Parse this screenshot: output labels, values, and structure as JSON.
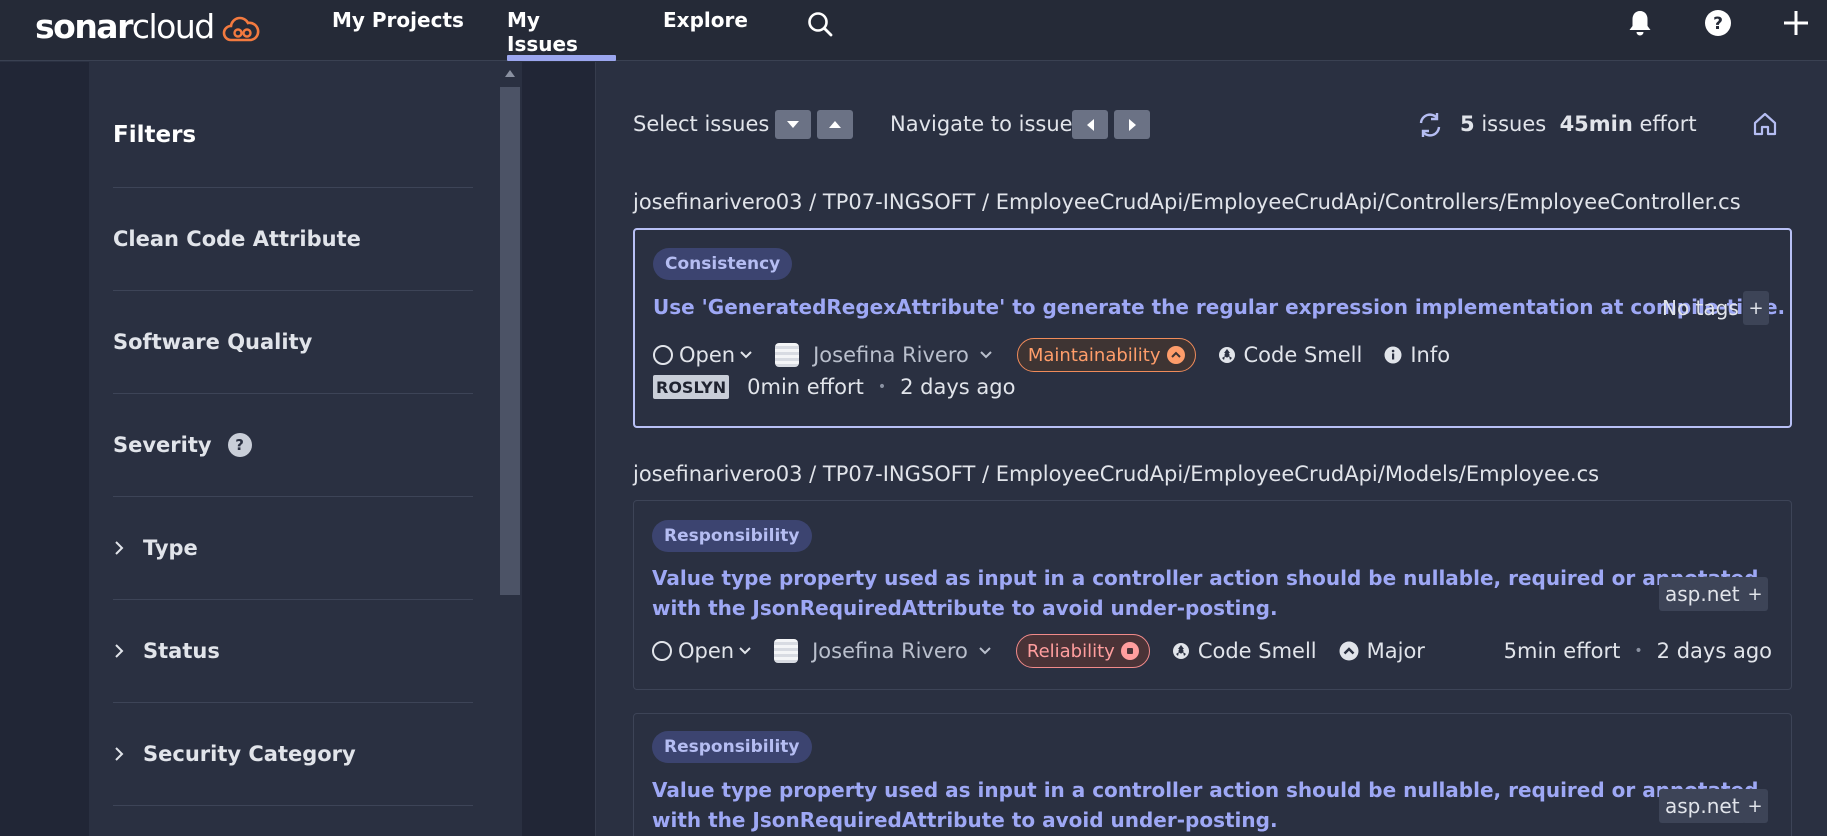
{
  "logo": {
    "bold": "sonar",
    "light": "cloud"
  },
  "nav": {
    "links": [
      {
        "label": "My Projects"
      },
      {
        "label": "My Issues"
      },
      {
        "label": "Explore"
      }
    ],
    "active": "My Issues"
  },
  "sidebar": {
    "title": "Filters",
    "facets": [
      {
        "label": "Clean Code Attribute",
        "expandable": false
      },
      {
        "label": "Software Quality",
        "expandable": false
      },
      {
        "label": "Severity",
        "expandable": false,
        "help": "?"
      },
      {
        "label": "Type",
        "expandable": true
      },
      {
        "label": "Status",
        "expandable": true
      },
      {
        "label": "Security Category",
        "expandable": true
      }
    ]
  },
  "toolbar": {
    "select_label": "Select issues",
    "navigate_label": "Navigate to issue",
    "issue_count": "5",
    "issues_word": "issues",
    "effort_value": "45min",
    "effort_word": "effort"
  },
  "issues": [
    {
      "path": "josefinarivero03 / TP07-INGSOFT / EmployeeCrudApi/EmployeeCrudApi/Controllers/EmployeeController.cs",
      "attribute": "Consistency",
      "message": "Use 'GeneratedRegexAttribute' to generate the regular expression implementation at compile-time.",
      "tags": "No tags",
      "status": "Open",
      "assignee": "Josefina Rivero",
      "quality": "Maintainability",
      "type": "Code Smell",
      "severity": "Info",
      "rule_badge": "ROSLYN",
      "effort": "0min effort",
      "age": "2 days ago"
    },
    {
      "path": "josefinarivero03 / TP07-INGSOFT / EmployeeCrudApi/EmployeeCrudApi/Models/Employee.cs",
      "attribute": "Responsibility",
      "message_line1": "Value type property used as input in a controller action should be nullable, required or annotated",
      "message_line2": "with the JsonRequiredAttribute to avoid under-posting.",
      "tags": "asp.net",
      "status": "Open",
      "assignee": "Josefina Rivero",
      "quality": "Reliability",
      "type": "Code Smell",
      "severity": "Major",
      "effort": "5min effort",
      "age": "2 days ago"
    },
    {
      "attribute": "Responsibility",
      "message_line1": "Value type property used as input in a controller action should be nullable, required or annotated",
      "message_line2": "with the JsonRequiredAttribute to avoid under-posting.",
      "tags": "asp.net"
    }
  ],
  "colors": {
    "background": "#2a3041",
    "nav_bg": "#252a37",
    "accent": "#9ea8f5",
    "maintainability": "#ff9d6a",
    "reliability": "#ff9e9e"
  },
  "icons": [
    "search-icon",
    "bell-icon",
    "help-icon",
    "plus-icon",
    "refresh-icon",
    "home-icon",
    "chevron-right-icon",
    "chevron-down-icon",
    "code-smell-icon",
    "info-icon",
    "major-icon"
  ]
}
